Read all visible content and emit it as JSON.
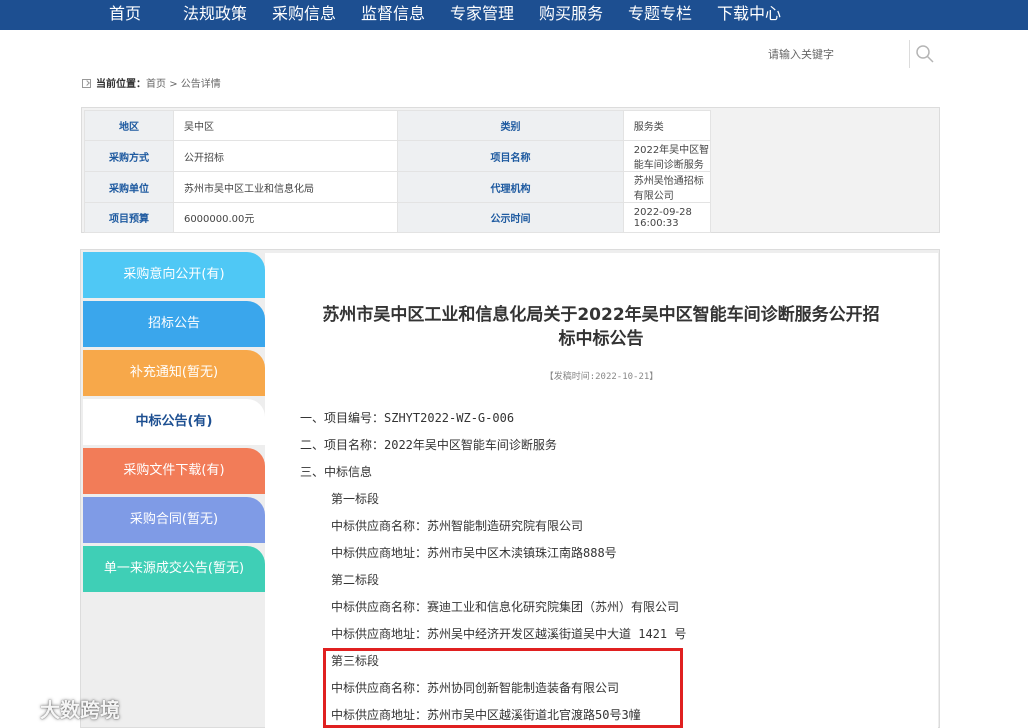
{
  "nav": {
    "items": [
      "首页",
      "法规政策",
      "采购信息",
      "监督信息",
      "专家管理",
      "购买服务",
      "专题专栏",
      "下载中心"
    ],
    "bg": "#1d4f91"
  },
  "search": {
    "placeholder": "请输入关键字",
    "icon": "search-icon"
  },
  "breadcrumb": {
    "label": "当前位置：",
    "home": "首页",
    "sep": ">",
    "current": "公告详情"
  },
  "info": {
    "rows": [
      {
        "l1": "地区",
        "v1": "吴中区",
        "l2": "类别",
        "v2": "服务类"
      },
      {
        "l1": "采购方式",
        "v1": "公开招标",
        "l2": "项目名称",
        "v2": "2022年吴中区智能车间诊断服务"
      },
      {
        "l1": "采购单位",
        "v1": "苏州市吴中区工业和信息化局",
        "l2": "代理机构",
        "v2": "苏州吴怡通招标有限公司"
      },
      {
        "l1": "项目预算",
        "v1": "6000000.00元",
        "l2": "公示时间",
        "v2": "2022-09-28 16:00:33"
      }
    ]
  },
  "sidebar": {
    "tabs": [
      {
        "label": "采购意向公开(有)",
        "color": "#4fc8f5"
      },
      {
        "label": "招标公告",
        "color": "#3aa6ec"
      },
      {
        "label": "补充通知(暂无)",
        "color": "#f7a84a"
      },
      {
        "label": "中标公告(有)",
        "active": true
      },
      {
        "label": "采购文件下载(有)",
        "color": "#f27c58"
      },
      {
        "label": "采购合同(暂无)",
        "color": "#7f9be6"
      },
      {
        "label": "单一来源成交公告(暂无)",
        "color": "#3fcfb6"
      }
    ]
  },
  "article": {
    "title_line1": "苏州市吴中区工业和信息化局关于2022年吴中区智能车间诊断服务公开招",
    "title_line2": "标中标公告",
    "pub_time": "【发稿时间:2022-10-21】",
    "lines": [
      "一、项目编号：SZHYT2022-WZ-G-006",
      "二、项目名称：2022年吴中区智能车间诊断服务",
      "三、中标信息",
      "第一标段",
      "中标供应商名称：苏州智能制造研究院有限公司",
      "中标供应商地址：苏州市吴中区木渎镇珠江南路888号",
      "第二标段",
      "中标供应商名称：赛迪工业和信息化研究院集团（苏州）有限公司",
      "中标供应商地址：苏州吴中经济开发区越溪街道吴中大道 1421 号",
      "第三标段",
      "中标供应商名称：苏州协同创新智能制造装备有限公司",
      "中标供应商地址：苏州市吴中区越溪街道北官渡路50号3幢"
    ]
  },
  "watermark": {
    "text": "大数跨境"
  }
}
